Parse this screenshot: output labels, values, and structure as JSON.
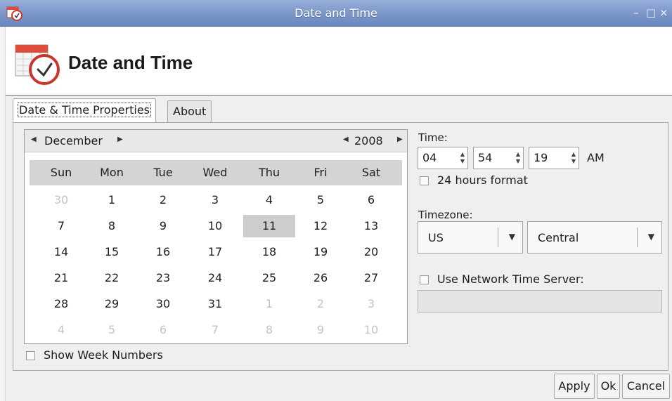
{
  "window": {
    "title": "Date and Time",
    "minimize_glyph": "–",
    "maximize_glyph": "□",
    "close_glyph": "×",
    "title_icon": "calendar-clock-icon"
  },
  "header": {
    "title": "Date and Time",
    "icon": "calendar-clock-icon"
  },
  "tabs": [
    {
      "label": "Date & Time Properties",
      "active": true
    },
    {
      "label": "About",
      "active": false
    }
  ],
  "calendar": {
    "month": "December",
    "year": "2008",
    "weekdays": [
      "Sun",
      "Mon",
      "Tue",
      "Wed",
      "Thu",
      "Fri",
      "Sat"
    ],
    "weeks": [
      [
        "30",
        "1",
        "2",
        "3",
        "4",
        "5",
        "6"
      ],
      [
        "7",
        "8",
        "9",
        "10",
        "11",
        "12",
        "13"
      ],
      [
        "14",
        "15",
        "16",
        "17",
        "18",
        "19",
        "20"
      ],
      [
        "21",
        "22",
        "23",
        "24",
        "25",
        "26",
        "27"
      ],
      [
        "28",
        "29",
        "30",
        "31",
        "1",
        "2",
        "3"
      ],
      [
        "4",
        "5",
        "6",
        "7",
        "8",
        "9",
        "10"
      ]
    ],
    "selected_day": "11",
    "show_week_numbers_label": "Show Week Numbers",
    "show_week_numbers": false
  },
  "time": {
    "label": "Time:",
    "hours": "04",
    "minutes": "54",
    "seconds": "19",
    "ampm": "AM",
    "format_24h_label": "24 hours format",
    "format_24h": false
  },
  "timezone": {
    "label": "Timezone:",
    "region": "US",
    "zone": "Central"
  },
  "ntp": {
    "label": "Use Network Time Server:",
    "enabled": false,
    "server": ""
  },
  "buttons": {
    "apply": "Apply",
    "ok": "Ok",
    "cancel": "Cancel"
  }
}
